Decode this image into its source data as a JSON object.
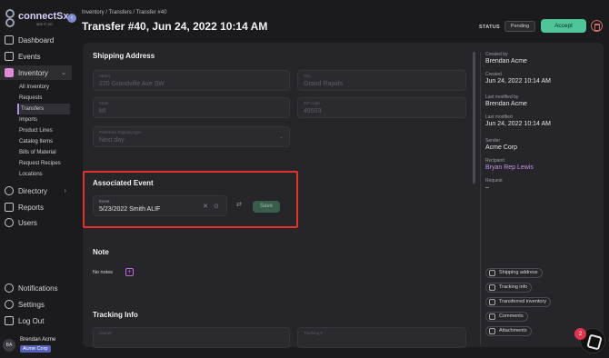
{
  "app": {
    "logo_text": "connectSx",
    "logo_sub": "SEE IT. DO",
    "collapse_badge": "‹"
  },
  "sidebar": {
    "nav": [
      {
        "label": "Dashboard",
        "icon": "grid-icon"
      },
      {
        "label": "Events",
        "icon": "calendar-icon"
      },
      {
        "label": "Inventory",
        "icon": "box-icon"
      },
      {
        "label": "Directory",
        "icon": "globe-icon"
      },
      {
        "label": "Reports",
        "icon": "chart-icon"
      },
      {
        "label": "Users",
        "icon": "users-icon"
      }
    ],
    "inventory_sub": [
      "All Inventory",
      "Requests",
      "Transfers",
      "Imports",
      "Product Lines",
      "Catalog Items",
      "Bills of Material",
      "Request Recipes",
      "Locations"
    ],
    "bottom": [
      {
        "label": "Notifications",
        "icon": "bell-icon"
      },
      {
        "label": "Settings",
        "icon": "gear-icon"
      },
      {
        "label": "Log Out",
        "icon": "logout-icon"
      }
    ],
    "user": {
      "initials": "BA",
      "name": "Brendan Acme",
      "org": "Acme Corp"
    }
  },
  "header": {
    "breadcrumb": [
      "Inventory",
      "Transfers",
      "Transfer #40"
    ],
    "title": "Transfer #40, Jun 24, 2022 10:14 AM",
    "status_label": "STATUS",
    "status_value": "Pending",
    "accept_label": "Accept"
  },
  "shipping": {
    "title": "Shipping Address",
    "street": {
      "label": "Street",
      "value": "220 Grandville Ave SW"
    },
    "city": {
      "label": "City",
      "value": "Grand Rapids"
    },
    "state": {
      "label": "State",
      "value": "MI"
    },
    "zip": {
      "label": "ZIP code",
      "value": "49503"
    },
    "shipping_type": {
      "label": "Preferred shipping type",
      "value": "Next day"
    }
  },
  "event": {
    "title": "Associated Event",
    "field_label": "Event",
    "field_value": "5/23/2022 Smith ALIF",
    "save_label": "Save"
  },
  "note": {
    "title": "Note",
    "empty": "No notes"
  },
  "tracking": {
    "title": "Tracking Info",
    "carrier_label": "Carrier",
    "tracking_label": "Tracking #"
  },
  "meta": {
    "created_by_label": "Created by",
    "created_by": "Brendan Acme",
    "created_label": "Created",
    "created": "Jun 24, 2022 10:14 AM",
    "modified_by_label": "Last modified by",
    "modified_by": "Brendan Acme",
    "modified_label": "Last modified",
    "modified": "Jun 24, 2022 10:14 AM",
    "sender_label": "Sender",
    "sender": "Acme Corp",
    "recipient_label": "Recipient",
    "recipient": "Bryan Rep Lewis",
    "request_label": "Request",
    "request": "–"
  },
  "side_links": [
    "Shipping address",
    "Tracking info",
    "Transferred inventory",
    "Comments",
    "Attachments"
  ],
  "help": {
    "badge": "2"
  }
}
